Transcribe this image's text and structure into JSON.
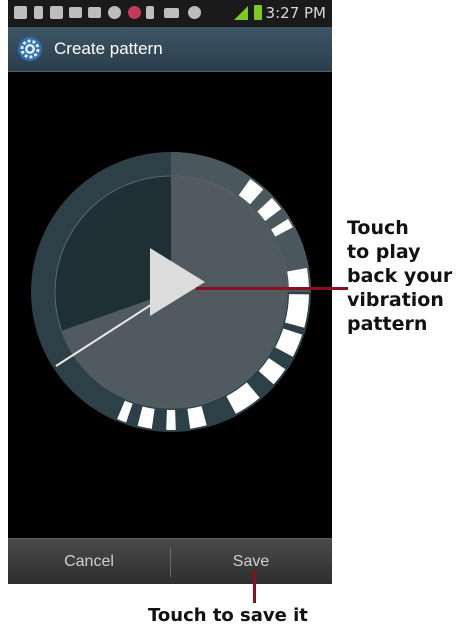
{
  "status_bar": {
    "time": "3:27 PM"
  },
  "action_bar": {
    "title": "Create pattern",
    "icon": "gear-icon"
  },
  "pattern": {
    "play_icon": "play-icon",
    "vibration_segments": 12
  },
  "buttons": {
    "cancel": "Cancel",
    "save": "Save"
  },
  "callouts": {
    "play_lines": [
      "Touch",
      "to play",
      "back your",
      "vibration",
      "pattern"
    ],
    "save": "Touch to save it"
  },
  "colors": {
    "callout_line": "#8b0f1e",
    "accent_green": "#7ec820"
  }
}
